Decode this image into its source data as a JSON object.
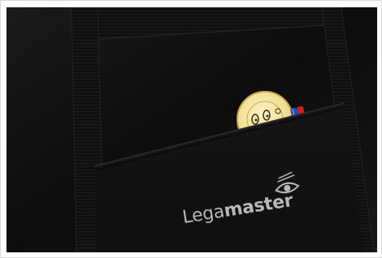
{
  "brand": {
    "prefix": "Lega",
    "suffix": "master"
  },
  "colors": {
    "bag": "#0c0c0d",
    "logo_text": "#b8b8ba",
    "magnet_face": "#f4e7a8",
    "marker_blue": "#1e4fb8",
    "marker_red": "#cc2020"
  },
  "icons": [
    "eye-logo-icon",
    "smiley-magnet",
    "marker-caps"
  ]
}
